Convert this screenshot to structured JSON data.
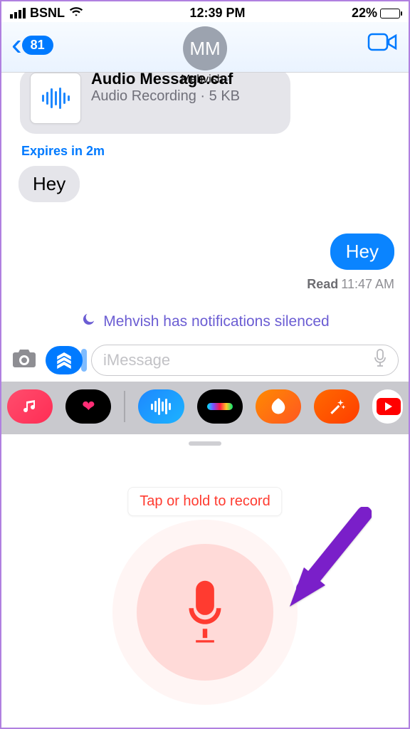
{
  "status": {
    "carrier": "BSNL",
    "time": "12:39 PM",
    "battery_percent": "22%"
  },
  "header": {
    "unread_count": "81",
    "contact_initials": "MM",
    "contact_name": "Mehvish"
  },
  "conversation": {
    "audio_attachment": {
      "title": "Audio Message.caf",
      "subtitle": "Audio Recording · 5 KB"
    },
    "expires_text": "Expires in 2m",
    "incoming_message": "Hey",
    "outgoing_message": "Hey",
    "read_receipt_label": "Read",
    "read_receipt_time": "11:47 AM",
    "silenced_text": "Mehvish has notifications silenced"
  },
  "compose": {
    "placeholder": "iMessage"
  },
  "drawer": {
    "hint": "Tap or hold to record"
  }
}
